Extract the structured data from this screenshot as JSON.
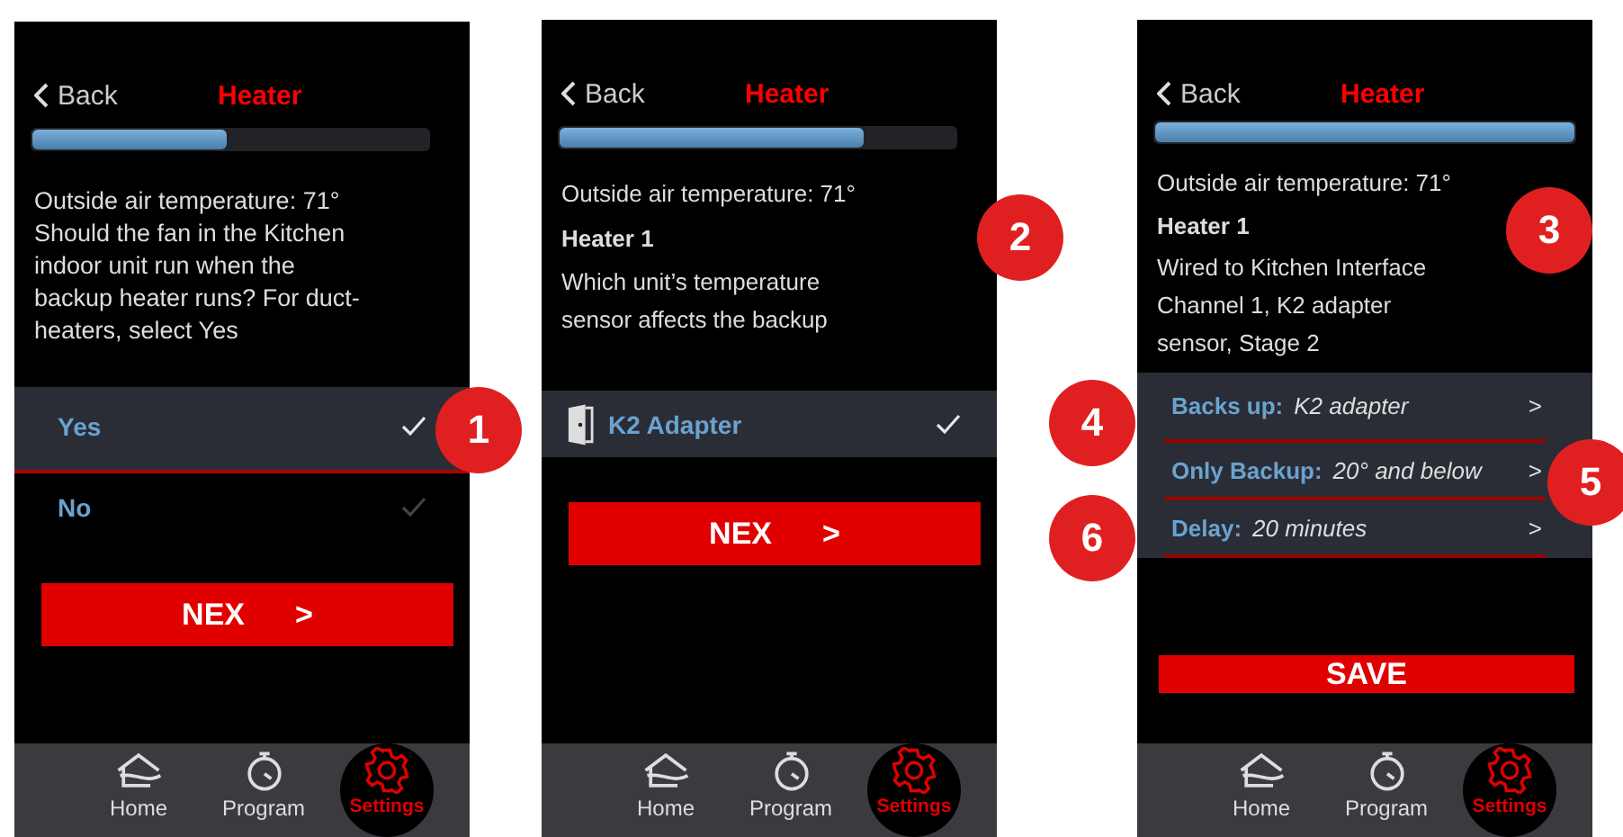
{
  "screens": [
    {
      "back": "Back",
      "title": "Heater",
      "progress": {
        "level": 0.49
      },
      "info": [
        {
          "kind": "plain",
          "text": "Outside air temperature: 71°\nShould the fan in the Kitchen\nindoor unit run when the\nbackup heater runs? For duct-\nheaters, select Yes"
        }
      ],
      "options": [
        {
          "kind": "choice",
          "label": "Yes",
          "selected": true
        },
        {
          "kind": "choice",
          "label": "No",
          "selected": false
        }
      ],
      "button": {
        "kind": "next",
        "label": "NEX",
        "arrow": ">"
      },
      "nav": [
        {
          "label": "Home",
          "selected": false
        },
        {
          "label": "Program",
          "selected": false
        },
        {
          "label": "Settings",
          "selected": true
        }
      ]
    },
    {
      "back": "Back",
      "title": "Heater",
      "progress": {
        "level": 0.77
      },
      "info": [
        {
          "kind": "plain",
          "text": "Outside air temperature: 71°"
        },
        {
          "kind": "bold",
          "text": "Heater  1"
        },
        {
          "kind": "plain",
          "text": "Which unit’s temperature\nsensor affects the backup"
        }
      ],
      "options": [
        {
          "kind": "device",
          "label": "K2 Adapter",
          "selected": true
        }
      ],
      "button": {
        "kind": "next",
        "label": "NEX",
        "arrow": ">"
      },
      "nav": [
        {
          "label": "Home",
          "selected": false
        },
        {
          "label": "Program",
          "selected": false
        },
        {
          "label": "Settings",
          "selected": true
        }
      ]
    },
    {
      "back": "Back",
      "title": "Heater",
      "progress": {
        "level": 1
      },
      "info": [
        {
          "kind": "plain",
          "text": "Outside air temperature: 71°"
        },
        {
          "kind": "bold",
          "text": "Heater 1"
        },
        {
          "kind": "plain",
          "text": "Wired to Kitchen Interface\nChannel 1, K2 adapter\nsensor, Stage 2"
        }
      ],
      "options": [
        {
          "kind": "setting",
          "label": "Backs up:",
          "value": "K2 adapter",
          "arrow": ">"
        },
        {
          "kind": "setting",
          "label": "Only Backup:",
          "value": "20° and below",
          "arrow": ">"
        },
        {
          "kind": "setting",
          "label": "Delay:",
          "value": "20 minutes",
          "arrow": ">"
        }
      ],
      "button": {
        "kind": "save",
        "label": "SAVE"
      },
      "nav": [
        {
          "label": "Home",
          "selected": false
        },
        {
          "label": "Program",
          "selected": false
        },
        {
          "label": "Settings",
          "selected": true
        }
      ]
    }
  ],
  "callouts": [
    {
      "number": "1"
    },
    {
      "number": "2"
    },
    {
      "number": "3"
    },
    {
      "number": "4"
    },
    {
      "number": "5"
    },
    {
      "number": "6"
    }
  ]
}
